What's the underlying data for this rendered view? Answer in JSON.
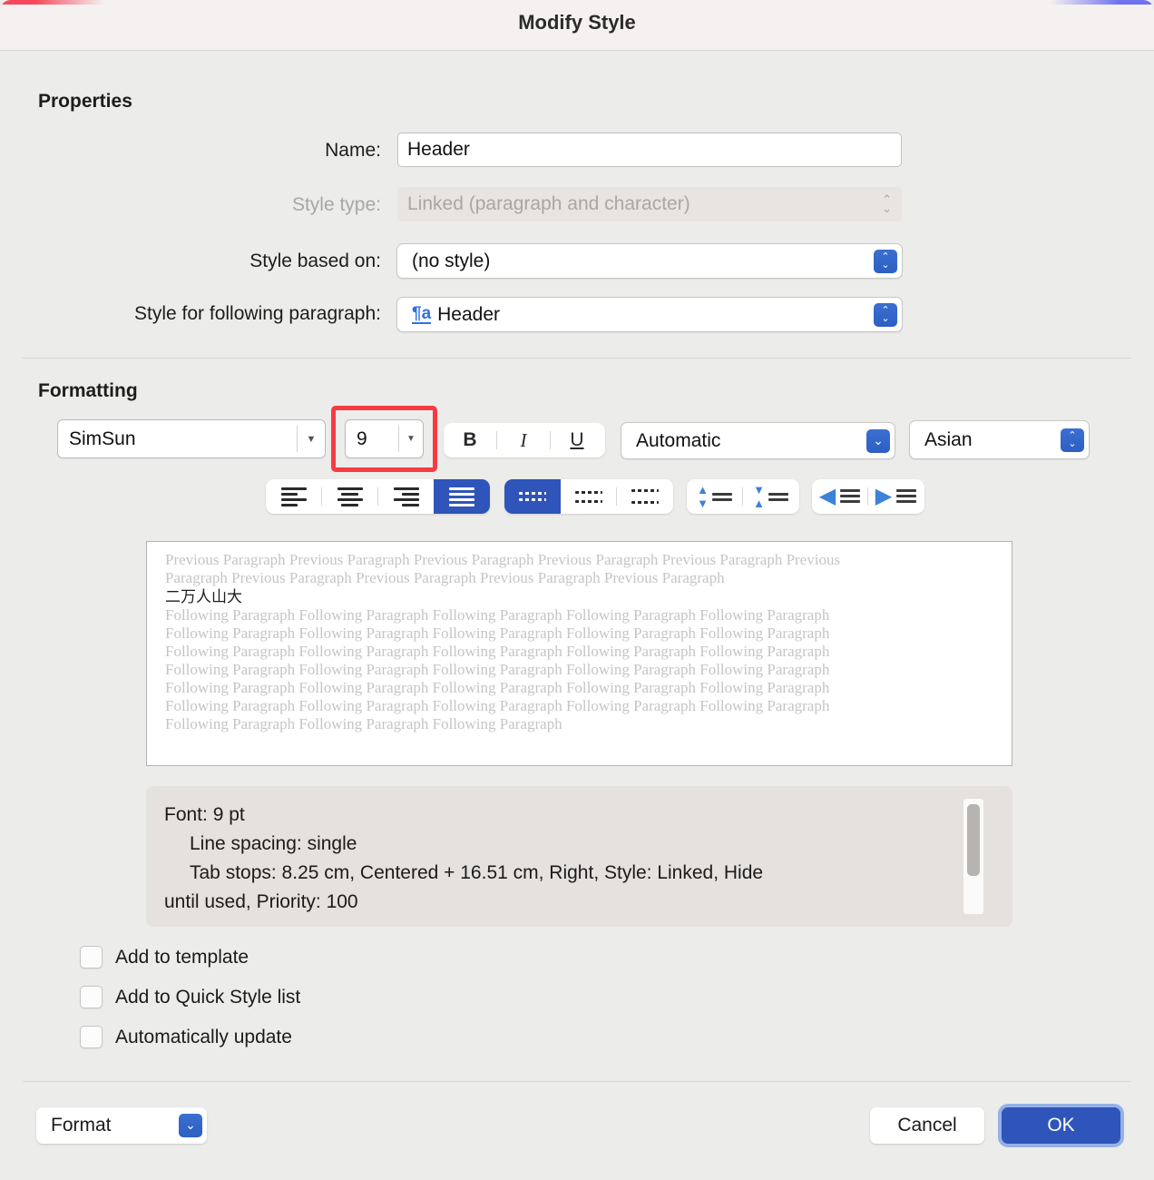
{
  "window": {
    "title": "Modify Style"
  },
  "properties": {
    "section_label": "Properties",
    "name_label": "Name:",
    "name_value": "Header",
    "style_type_label": "Style type:",
    "style_type_value": "Linked (paragraph and character)",
    "style_based_on_label": "Style based on:",
    "style_based_on_value": "(no style)",
    "style_following_label": "Style for following paragraph:",
    "style_following_value": "Header",
    "style_following_icon": "paragraph-character-style-icon",
    "style_following_icon_glyph": "¶a"
  },
  "formatting": {
    "section_label": "Formatting",
    "font_name": "SimSun",
    "font_size": "9",
    "bold_label": "B",
    "italic_label": "I",
    "underline_label": "U",
    "font_color": "Automatic",
    "script_set": "Asian",
    "highlight_color": "#f73b44",
    "accent_color": "#2f55ba",
    "align_buttons": [
      {
        "name": "align-left-button",
        "selected": false
      },
      {
        "name": "align-center-button",
        "selected": false
      },
      {
        "name": "align-right-button",
        "selected": false
      },
      {
        "name": "align-justify-button",
        "selected": true
      }
    ],
    "line_spacing_buttons": [
      {
        "name": "line-spacing-single-button",
        "selected": true
      },
      {
        "name": "line-spacing-1-5-button",
        "selected": false
      },
      {
        "name": "line-spacing-double-button",
        "selected": false
      }
    ],
    "paragraph_spacing_buttons": [
      {
        "name": "decrease-paragraph-spacing-button"
      },
      {
        "name": "increase-paragraph-spacing-button"
      }
    ],
    "indent_buttons": [
      {
        "name": "decrease-indent-button"
      },
      {
        "name": "increase-indent-button"
      }
    ]
  },
  "preview": {
    "previous_lines": [
      "Previous Paragraph Previous Paragraph Previous Paragraph Previous Paragraph Previous Paragraph Previous",
      "Paragraph Previous Paragraph Previous Paragraph Previous Paragraph Previous Paragraph"
    ],
    "sample_text": "二万人山大",
    "following_lines": [
      "Following Paragraph Following Paragraph Following Paragraph Following Paragraph Following Paragraph",
      "Following Paragraph Following Paragraph Following Paragraph Following Paragraph Following Paragraph",
      "Following Paragraph Following Paragraph Following Paragraph Following Paragraph Following Paragraph",
      "Following Paragraph Following Paragraph Following Paragraph Following Paragraph Following Paragraph",
      "Following Paragraph Following Paragraph Following Paragraph Following Paragraph Following Paragraph",
      "Following Paragraph Following Paragraph Following Paragraph Following Paragraph Following Paragraph",
      "Following Paragraph Following Paragraph Following Paragraph"
    ]
  },
  "description": {
    "lines": [
      "Font: 9 pt",
      "Line spacing:  single",
      "Tab stops:  8.25 cm, Centered +  16.51 cm, Right, Style: Linked, Hide",
      "until used, Priority: 100"
    ]
  },
  "options": [
    {
      "name": "add-to-template-checkbox",
      "label": "Add to template",
      "checked": false
    },
    {
      "name": "add-to-quick-style-list-checkbox",
      "label": "Add to Quick Style list",
      "checked": false
    },
    {
      "name": "automatically-update-checkbox",
      "label": "Automatically update",
      "checked": false
    }
  ],
  "footer": {
    "format_label": "Format",
    "cancel_label": "Cancel",
    "ok_label": "OK"
  }
}
